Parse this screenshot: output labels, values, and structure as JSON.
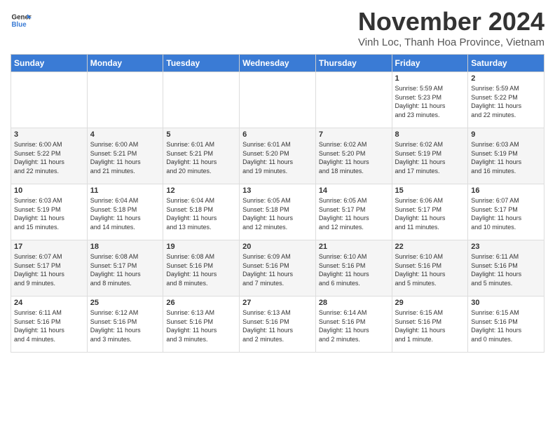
{
  "logo": {
    "general": "General",
    "blue": "Blue"
  },
  "header": {
    "month": "November 2024",
    "location": "Vinh Loc, Thanh Hoa Province, Vietnam"
  },
  "weekdays": [
    "Sunday",
    "Monday",
    "Tuesday",
    "Wednesday",
    "Thursday",
    "Friday",
    "Saturday"
  ],
  "weeks": [
    [
      {
        "day": "",
        "info": ""
      },
      {
        "day": "",
        "info": ""
      },
      {
        "day": "",
        "info": ""
      },
      {
        "day": "",
        "info": ""
      },
      {
        "day": "",
        "info": ""
      },
      {
        "day": "1",
        "info": "Sunrise: 5:59 AM\nSunset: 5:23 PM\nDaylight: 11 hours\nand 23 minutes."
      },
      {
        "day": "2",
        "info": "Sunrise: 5:59 AM\nSunset: 5:22 PM\nDaylight: 11 hours\nand 22 minutes."
      }
    ],
    [
      {
        "day": "3",
        "info": "Sunrise: 6:00 AM\nSunset: 5:22 PM\nDaylight: 11 hours\nand 22 minutes."
      },
      {
        "day": "4",
        "info": "Sunrise: 6:00 AM\nSunset: 5:21 PM\nDaylight: 11 hours\nand 21 minutes."
      },
      {
        "day": "5",
        "info": "Sunrise: 6:01 AM\nSunset: 5:21 PM\nDaylight: 11 hours\nand 20 minutes."
      },
      {
        "day": "6",
        "info": "Sunrise: 6:01 AM\nSunset: 5:20 PM\nDaylight: 11 hours\nand 19 minutes."
      },
      {
        "day": "7",
        "info": "Sunrise: 6:02 AM\nSunset: 5:20 PM\nDaylight: 11 hours\nand 18 minutes."
      },
      {
        "day": "8",
        "info": "Sunrise: 6:02 AM\nSunset: 5:19 PM\nDaylight: 11 hours\nand 17 minutes."
      },
      {
        "day": "9",
        "info": "Sunrise: 6:03 AM\nSunset: 5:19 PM\nDaylight: 11 hours\nand 16 minutes."
      }
    ],
    [
      {
        "day": "10",
        "info": "Sunrise: 6:03 AM\nSunset: 5:19 PM\nDaylight: 11 hours\nand 15 minutes."
      },
      {
        "day": "11",
        "info": "Sunrise: 6:04 AM\nSunset: 5:18 PM\nDaylight: 11 hours\nand 14 minutes."
      },
      {
        "day": "12",
        "info": "Sunrise: 6:04 AM\nSunset: 5:18 PM\nDaylight: 11 hours\nand 13 minutes."
      },
      {
        "day": "13",
        "info": "Sunrise: 6:05 AM\nSunset: 5:18 PM\nDaylight: 11 hours\nand 12 minutes."
      },
      {
        "day": "14",
        "info": "Sunrise: 6:05 AM\nSunset: 5:17 PM\nDaylight: 11 hours\nand 12 minutes."
      },
      {
        "day": "15",
        "info": "Sunrise: 6:06 AM\nSunset: 5:17 PM\nDaylight: 11 hours\nand 11 minutes."
      },
      {
        "day": "16",
        "info": "Sunrise: 6:07 AM\nSunset: 5:17 PM\nDaylight: 11 hours\nand 10 minutes."
      }
    ],
    [
      {
        "day": "17",
        "info": "Sunrise: 6:07 AM\nSunset: 5:17 PM\nDaylight: 11 hours\nand 9 minutes."
      },
      {
        "day": "18",
        "info": "Sunrise: 6:08 AM\nSunset: 5:17 PM\nDaylight: 11 hours\nand 8 minutes."
      },
      {
        "day": "19",
        "info": "Sunrise: 6:08 AM\nSunset: 5:16 PM\nDaylight: 11 hours\nand 8 minutes."
      },
      {
        "day": "20",
        "info": "Sunrise: 6:09 AM\nSunset: 5:16 PM\nDaylight: 11 hours\nand 7 minutes."
      },
      {
        "day": "21",
        "info": "Sunrise: 6:10 AM\nSunset: 5:16 PM\nDaylight: 11 hours\nand 6 minutes."
      },
      {
        "day": "22",
        "info": "Sunrise: 6:10 AM\nSunset: 5:16 PM\nDaylight: 11 hours\nand 5 minutes."
      },
      {
        "day": "23",
        "info": "Sunrise: 6:11 AM\nSunset: 5:16 PM\nDaylight: 11 hours\nand 5 minutes."
      }
    ],
    [
      {
        "day": "24",
        "info": "Sunrise: 6:11 AM\nSunset: 5:16 PM\nDaylight: 11 hours\nand 4 minutes."
      },
      {
        "day": "25",
        "info": "Sunrise: 6:12 AM\nSunset: 5:16 PM\nDaylight: 11 hours\nand 3 minutes."
      },
      {
        "day": "26",
        "info": "Sunrise: 6:13 AM\nSunset: 5:16 PM\nDaylight: 11 hours\nand 3 minutes."
      },
      {
        "day": "27",
        "info": "Sunrise: 6:13 AM\nSunset: 5:16 PM\nDaylight: 11 hours\nand 2 minutes."
      },
      {
        "day": "28",
        "info": "Sunrise: 6:14 AM\nSunset: 5:16 PM\nDaylight: 11 hours\nand 2 minutes."
      },
      {
        "day": "29",
        "info": "Sunrise: 6:15 AM\nSunset: 5:16 PM\nDaylight: 11 hours\nand 1 minute."
      },
      {
        "day": "30",
        "info": "Sunrise: 6:15 AM\nSunset: 5:16 PM\nDaylight: 11 hours\nand 0 minutes."
      }
    ]
  ]
}
